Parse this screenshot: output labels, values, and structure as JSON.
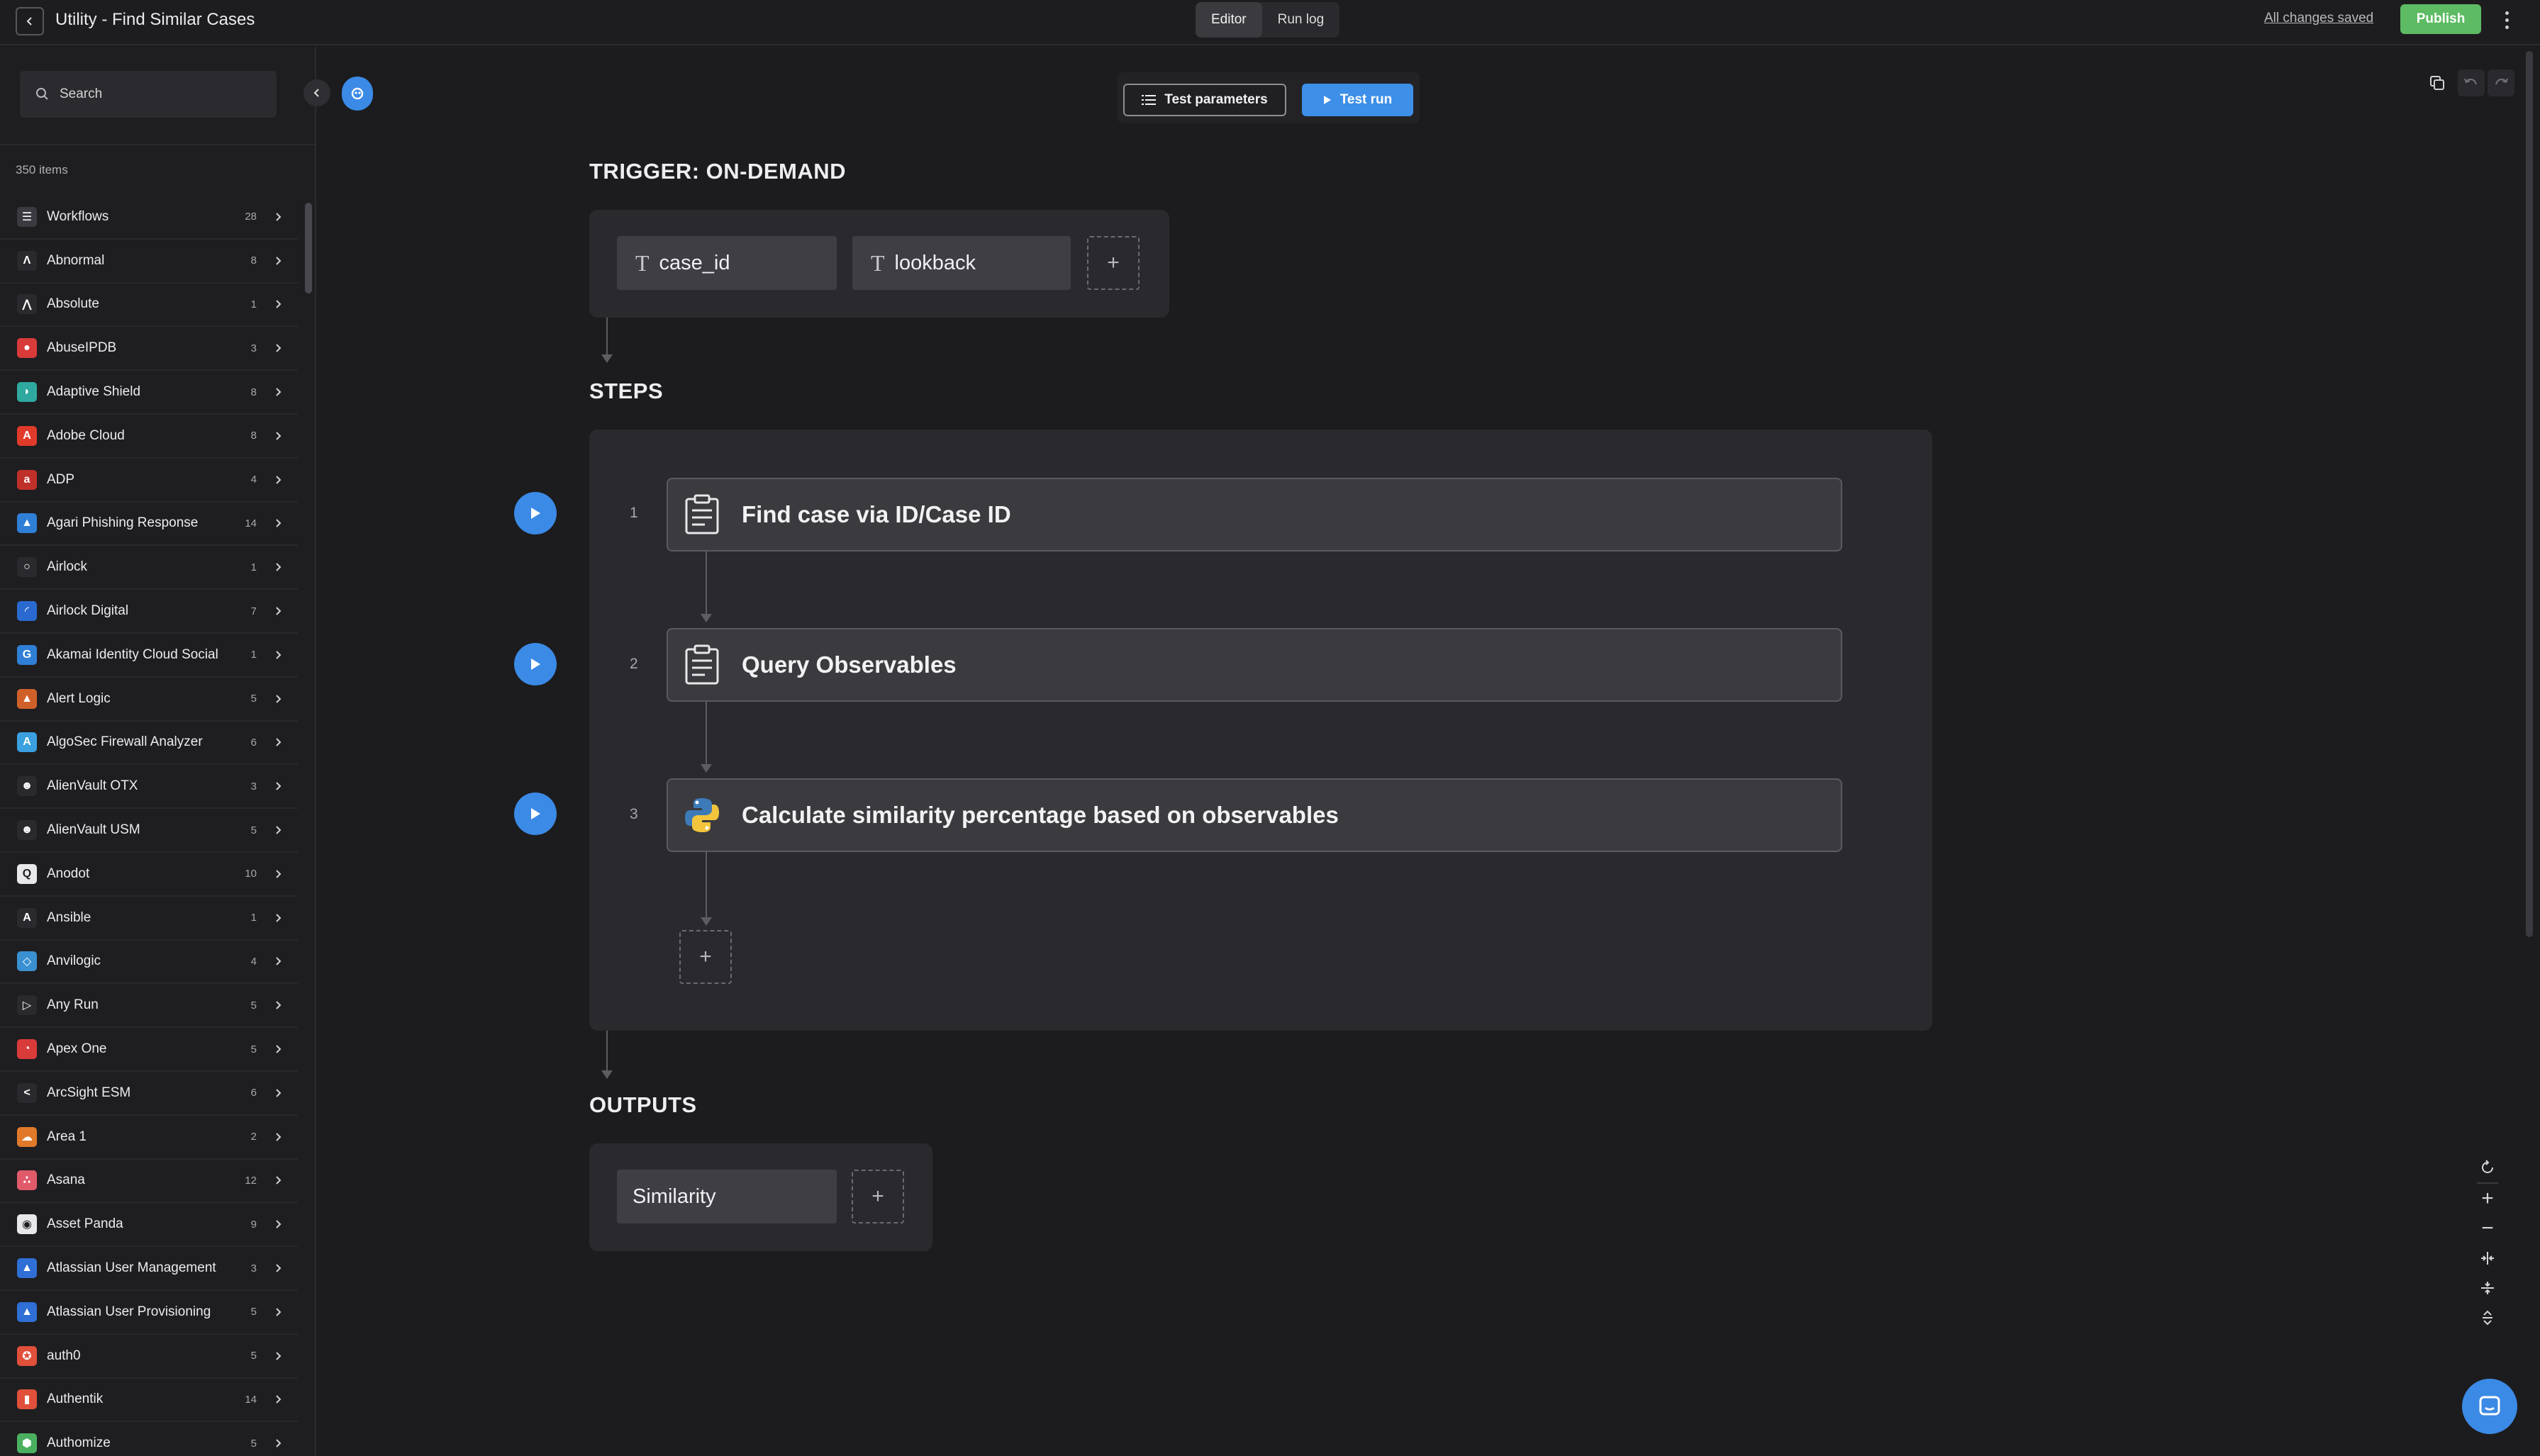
{
  "topbar": {
    "title": "Utility - Find Similar Cases",
    "tabs": [
      {
        "label": "Editor",
        "active": true
      },
      {
        "label": "Run log",
        "active": false
      }
    ],
    "saved_status": "All changes saved",
    "publish_label": "Publish"
  },
  "sidebar": {
    "search_placeholder": "Search",
    "item_count": "350 items",
    "items": [
      {
        "name": "Workflows",
        "count": "28",
        "color": "#3a3a40",
        "glyph": "☰"
      },
      {
        "name": "Abnormal",
        "count": "8",
        "color": "#2a2a2e",
        "glyph": "Λ"
      },
      {
        "name": "Absolute",
        "count": "1",
        "color": "#2a2a2e",
        "glyph": "⋀"
      },
      {
        "name": "AbuseIPDB",
        "count": "3",
        "color": "#d93a3a",
        "glyph": "●"
      },
      {
        "name": "Adaptive Shield",
        "count": "8",
        "color": "#2fa8a0",
        "glyph": "◗"
      },
      {
        "name": "Adobe Cloud",
        "count": "8",
        "color": "#e03a2a",
        "glyph": "A"
      },
      {
        "name": "ADP",
        "count": "4",
        "color": "#c0302a",
        "glyph": "a"
      },
      {
        "name": "Agari Phishing Response",
        "count": "14",
        "color": "#2f7fd6",
        "glyph": "▲"
      },
      {
        "name": "Airlock",
        "count": "1",
        "color": "#2a2a2e",
        "glyph": "○"
      },
      {
        "name": "Airlock Digital",
        "count": "7",
        "color": "#2a6ad0",
        "glyph": "◜"
      },
      {
        "name": "Akamai Identity Cloud Social",
        "count": "1",
        "color": "#2f7fd6",
        "glyph": "G"
      },
      {
        "name": "Alert Logic",
        "count": "5",
        "color": "#d0602a",
        "glyph": "▲"
      },
      {
        "name": "AlgoSec Firewall Analyzer",
        "count": "6",
        "color": "#3aa0e0",
        "glyph": "A"
      },
      {
        "name": "AlienVault OTX",
        "count": "3",
        "color": "#2a2a2e",
        "glyph": "☻"
      },
      {
        "name": "AlienVault USM",
        "count": "5",
        "color": "#2a2a2e",
        "glyph": "☻"
      },
      {
        "name": "Anodot",
        "count": "10",
        "color": "#e8e8ea",
        "glyph": "Q"
      },
      {
        "name": "Ansible",
        "count": "1",
        "color": "#2a2a2e",
        "glyph": "A"
      },
      {
        "name": "Anvilogic",
        "count": "4",
        "color": "#3a90d0",
        "glyph": "◇"
      },
      {
        "name": "Any Run",
        "count": "5",
        "color": "#2a2a2e",
        "glyph": "▷"
      },
      {
        "name": "Apex One",
        "count": "5",
        "color": "#d93a3a",
        "glyph": "◔"
      },
      {
        "name": "ArcSight ESM",
        "count": "6",
        "color": "#2a2a2e",
        "glyph": "<"
      },
      {
        "name": "Area 1",
        "count": "2",
        "color": "#e07a2a",
        "glyph": "☁"
      },
      {
        "name": "Asana",
        "count": "12",
        "color": "#e05a6a",
        "glyph": "∴"
      },
      {
        "name": "Asset Panda",
        "count": "9",
        "color": "#e8e8ea",
        "glyph": "◉"
      },
      {
        "name": "Atlassian User Management",
        "count": "3",
        "color": "#2f6fd6",
        "glyph": "▲"
      },
      {
        "name": "Atlassian User Provisioning",
        "count": "5",
        "color": "#2f6fd6",
        "glyph": "▲"
      },
      {
        "name": "auth0",
        "count": "5",
        "color": "#e0503a",
        "glyph": "✪"
      },
      {
        "name": "Authentik",
        "count": "14",
        "color": "#e0503a",
        "glyph": "▮"
      },
      {
        "name": "Authomize",
        "count": "5",
        "color": "#4ab060",
        "glyph": "⬢"
      }
    ]
  },
  "toolbar": {
    "test_params_label": "Test parameters",
    "test_run_label": "Test run"
  },
  "trigger": {
    "title": "TRIGGER: ON-DEMAND",
    "params": [
      "case_id",
      "lookback"
    ]
  },
  "steps": {
    "title": "STEPS",
    "items": [
      {
        "num": "1",
        "label": "Find case via ID/Case ID",
        "icon": "clipboard-icon"
      },
      {
        "num": "2",
        "label": "Query Observables",
        "icon": "clipboard-icon"
      },
      {
        "num": "3",
        "label": "Calculate similarity percentage based on observables",
        "icon": "python-icon"
      }
    ]
  },
  "outputs": {
    "title": "OUTPUTS",
    "items": [
      "Similarity"
    ]
  },
  "colors": {
    "accent": "#3b8ae6",
    "publish": "#5dbb63",
    "background": "#1c1c1e"
  }
}
